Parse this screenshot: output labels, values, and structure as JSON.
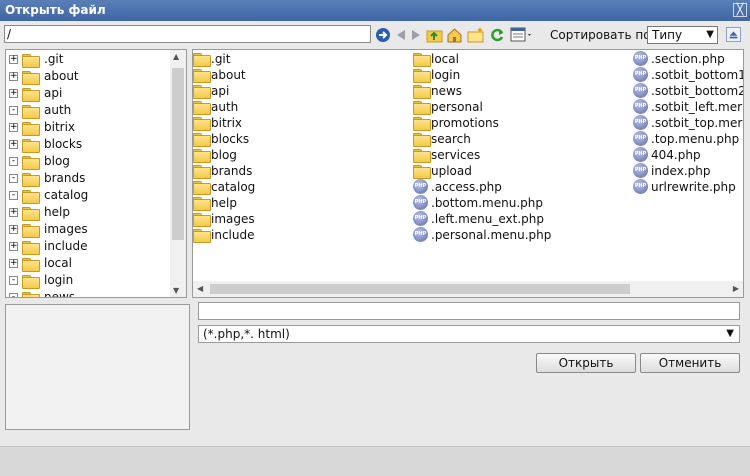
{
  "dialog": {
    "title": "Открыть файл",
    "close_symbol": "╳"
  },
  "path": {
    "value": "/"
  },
  "toolbar": {
    "icons": [
      "go-arrow-icon",
      "back-arrow-icon",
      "forward-arrow-icon",
      "folder-up-icon",
      "home-folder-icon",
      "new-folder-icon",
      "refresh-icon",
      "view-mode-icon"
    ],
    "sort_label": "Сортировать по:",
    "sort_value": "Типу",
    "sort_arrow": "▼"
  },
  "tree": {
    "items": [
      {
        "label": ".git",
        "toggle": "+"
      },
      {
        "label": "about",
        "toggle": "+"
      },
      {
        "label": "api",
        "toggle": "+"
      },
      {
        "label": "auth",
        "toggle": "-"
      },
      {
        "label": "bitrix",
        "toggle": "+"
      },
      {
        "label": "blocks",
        "toggle": "+"
      },
      {
        "label": "blog",
        "toggle": "-"
      },
      {
        "label": "brands",
        "toggle": "-"
      },
      {
        "label": "catalog",
        "toggle": "-"
      },
      {
        "label": "help",
        "toggle": "+"
      },
      {
        "label": "images",
        "toggle": "+"
      },
      {
        "label": "include",
        "toggle": "+"
      },
      {
        "label": "local",
        "toggle": "+"
      },
      {
        "label": "login",
        "toggle": "-"
      },
      {
        "label": "news",
        "toggle": "-"
      }
    ]
  },
  "files": {
    "columns": [
      [
        {
          "name": ".git",
          "type": "folder"
        },
        {
          "name": "about",
          "type": "folder"
        },
        {
          "name": "api",
          "type": "folder"
        },
        {
          "name": "auth",
          "type": "folder"
        },
        {
          "name": "bitrix",
          "type": "folder"
        },
        {
          "name": "blocks",
          "type": "folder"
        },
        {
          "name": "blog",
          "type": "folder"
        },
        {
          "name": "brands",
          "type": "folder"
        },
        {
          "name": "catalog",
          "type": "folder"
        },
        {
          "name": "help",
          "type": "folder"
        },
        {
          "name": "images",
          "type": "folder"
        },
        {
          "name": "include",
          "type": "folder"
        }
      ],
      [
        {
          "name": "local",
          "type": "folder"
        },
        {
          "name": "login",
          "type": "folder"
        },
        {
          "name": "news",
          "type": "folder"
        },
        {
          "name": "personal",
          "type": "folder"
        },
        {
          "name": "promotions",
          "type": "folder"
        },
        {
          "name": "search",
          "type": "folder"
        },
        {
          "name": "services",
          "type": "folder"
        },
        {
          "name": "upload",
          "type": "folder"
        },
        {
          "name": ".access.php",
          "type": "php"
        },
        {
          "name": ".bottom.menu.php",
          "type": "php"
        },
        {
          "name": ".left.menu_ext.php",
          "type": "php"
        },
        {
          "name": ".personal.menu.php",
          "type": "php"
        }
      ],
      [
        {
          "name": ".section.php",
          "type": "php"
        },
        {
          "name": ".sotbit_bottom1",
          "type": "php"
        },
        {
          "name": ".sotbit_bottom2",
          "type": "php"
        },
        {
          "name": ".sotbit_left.mer",
          "type": "php"
        },
        {
          "name": ".sotbit_top.mer",
          "type": "php"
        },
        {
          "name": ".top.menu.php",
          "type": "php"
        },
        {
          "name": "404.php",
          "type": "php"
        },
        {
          "name": "index.php",
          "type": "php"
        },
        {
          "name": "urlrewrite.php",
          "type": "php"
        }
      ]
    ]
  },
  "php_badge": "PHP",
  "filename": {
    "value": ""
  },
  "filter": {
    "value": "(*.php,*. html)",
    "arrow": "▼"
  },
  "buttons": {
    "open": "Открыть",
    "cancel": "Отменить"
  },
  "colors": {
    "title_bar": "#3f66a4",
    "folder": "#f5c94a",
    "php_icon": "#5c6aa8"
  }
}
